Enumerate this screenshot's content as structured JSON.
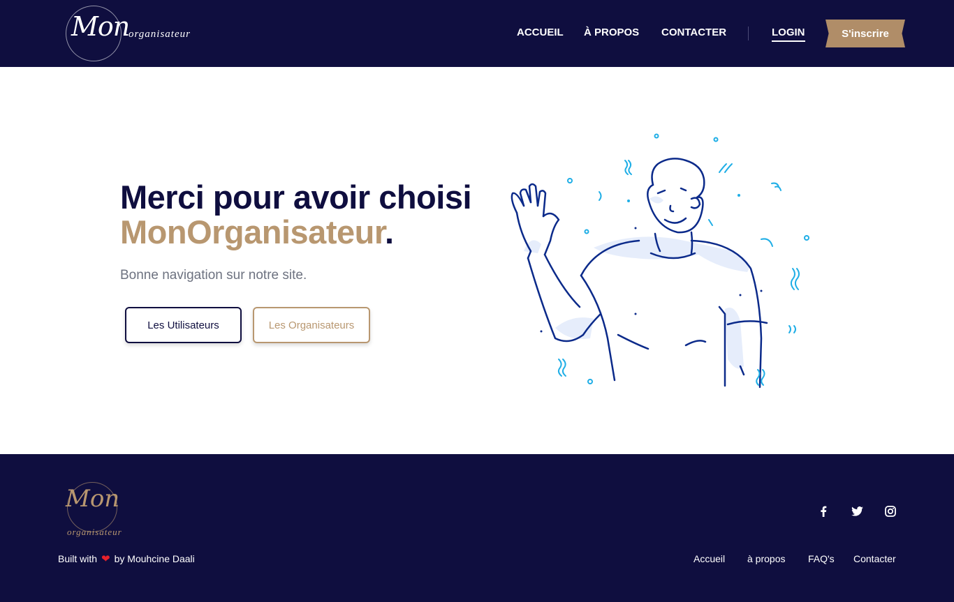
{
  "header": {
    "logo_script": "Mon",
    "logo_sub": "organisateur",
    "nav": {
      "accueil": "ACCUEIL",
      "apropos": "À PROPOS",
      "contacter": "CONTACTER",
      "login": "LOGIN"
    },
    "signup": "S'inscrire"
  },
  "hero": {
    "title_line1": "Merci pour avoir choisi",
    "title_brand": "MonOrganisateur",
    "title_period": ".",
    "subtitle": "Bonne navigation sur notre site.",
    "btn_users": "Les Utilisateurs",
    "btn_orgs": "Les Organisateurs"
  },
  "footer": {
    "logo_script": "Mon",
    "logo_sub": "organisateur",
    "built_prefix": "Built with",
    "built_suffix": "by Mouhcine Daali",
    "social": [
      "facebook-icon",
      "twitter-icon",
      "instagram-icon"
    ],
    "links": {
      "accueil": "Accueil",
      "apropos": "à propos",
      "faq": "FAQ's",
      "contacter": "Contacter"
    }
  },
  "colors": {
    "navy": "#0f0e3f",
    "gold": "#b89770",
    "signup_bg": "#b08d68",
    "heart": "#e8212b"
  }
}
